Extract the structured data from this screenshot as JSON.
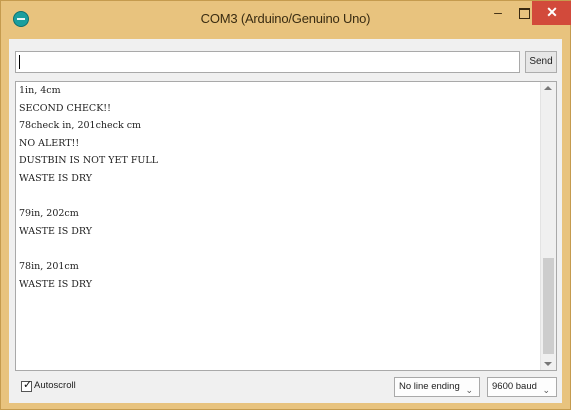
{
  "window": {
    "title": "COM3 (Arduino/Genuino Uno)",
    "colors": {
      "titlebar": "#e8c37e",
      "close": "#d24a3b",
      "client": "#f0f0f0"
    }
  },
  "titlebar": {
    "icon": "arduino-icon",
    "minimize_glyph": "–",
    "close_glyph": "✕"
  },
  "input": {
    "value": "",
    "send_label": "Send"
  },
  "output": {
    "lines": [
      "1in, 4cm",
      "SECOND CHECK!!",
      "78check in, 201check cm",
      "NO ALERT!!",
      "DUSTBIN IS NOT YET FULL",
      "WASTE IS DRY",
      "",
      "79in, 202cm",
      "WASTE IS DRY",
      "",
      "78in, 201cm",
      "WASTE IS DRY"
    ]
  },
  "footer": {
    "autoscroll_label": "Autoscroll",
    "autoscroll_checked": true,
    "line_ending": "No line ending",
    "baud": "9600 baud"
  }
}
